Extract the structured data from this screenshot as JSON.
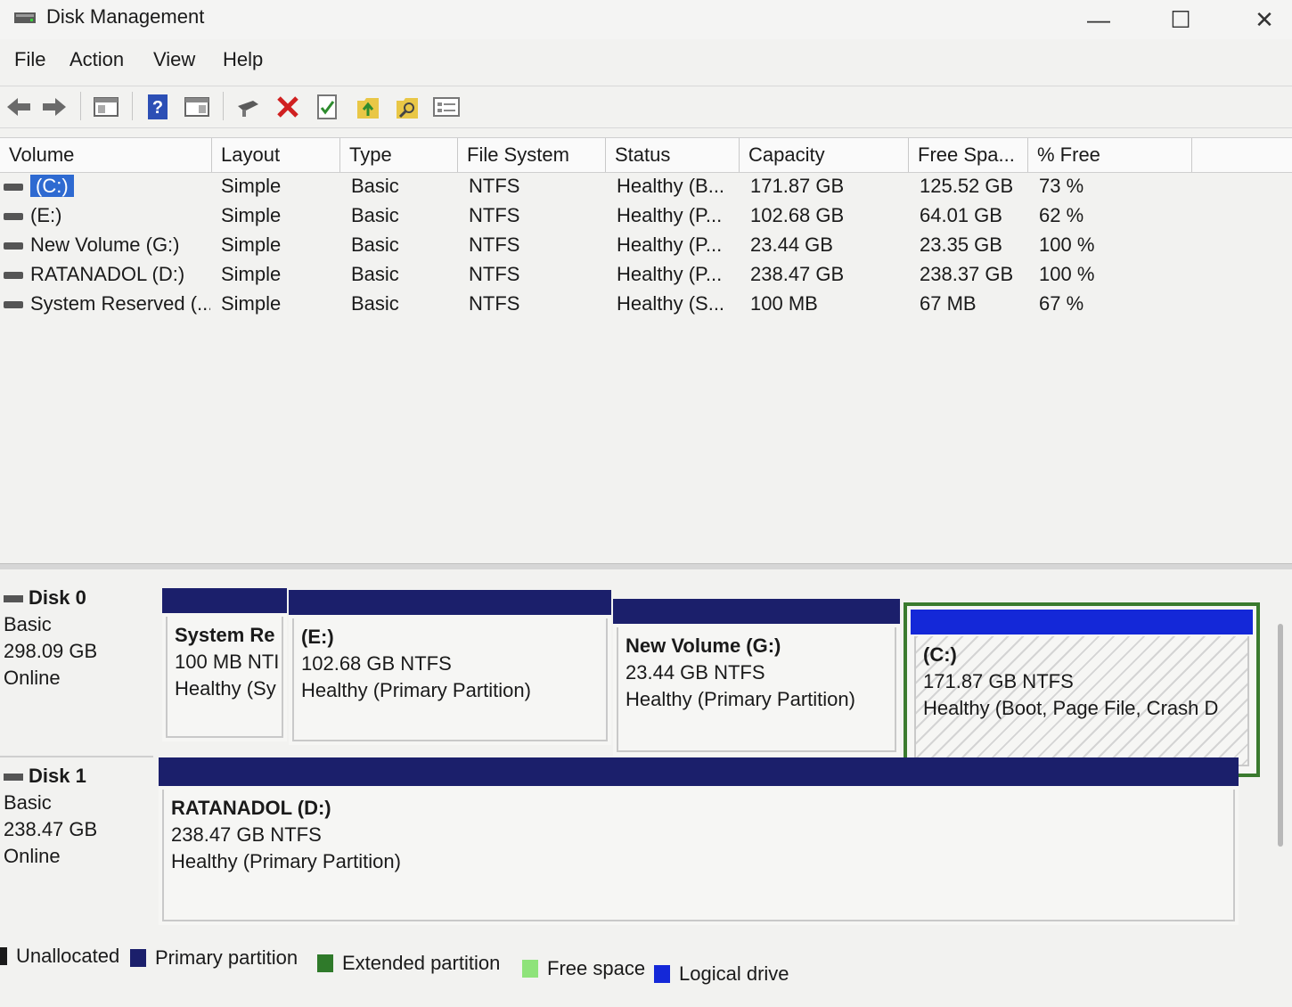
{
  "window": {
    "title": "Disk Management",
    "minimize": "—",
    "maximize": "☐",
    "close": "✕"
  },
  "menu": {
    "file": "File",
    "action": "Action",
    "view": "View",
    "help": "Help"
  },
  "toolbar": {
    "icons": [
      "back-arrow-icon",
      "forward-arrow-icon",
      "console-tree-icon",
      "help-icon",
      "show-hide-icon",
      "connect-icon",
      "delete-icon",
      "properties-icon",
      "export-icon",
      "search-icon",
      "settings-list-icon"
    ]
  },
  "columns": [
    "Volume",
    "Layout",
    "Type",
    "File System",
    "Status",
    "Capacity",
    "Free Spa...",
    "% Free"
  ],
  "volumes": [
    {
      "volume": "(C:)",
      "layout": "Simple",
      "type": "Basic",
      "fs": "NTFS",
      "status": "Healthy (B...",
      "capacity": "171.87 GB",
      "free": "125.52 GB",
      "pct": "73 %"
    },
    {
      "volume": "(E:)",
      "layout": "Simple",
      "type": "Basic",
      "fs": "NTFS",
      "status": "Healthy (P...",
      "capacity": "102.68 GB",
      "free": "64.01 GB",
      "pct": "62 %"
    },
    {
      "volume": "New Volume (G:)",
      "layout": "Simple",
      "type": "Basic",
      "fs": "NTFS",
      "status": "Healthy (P...",
      "capacity": "23.44 GB",
      "free": "23.35 GB",
      "pct": "100 %"
    },
    {
      "volume": "RATANADOL (D:)",
      "layout": "Simple",
      "type": "Basic",
      "fs": "NTFS",
      "status": "Healthy (P...",
      "capacity": "238.47 GB",
      "free": "238.37 GB",
      "pct": "100 %"
    },
    {
      "volume": "System Reserved (...",
      "layout": "Simple",
      "type": "Basic",
      "fs": "NTFS",
      "status": "Healthy (S...",
      "capacity": "100 MB",
      "free": "67 MB",
      "pct": "67 %"
    }
  ],
  "disks": [
    {
      "name": "Disk 0",
      "type": "Basic",
      "size": "298.09 GB",
      "state": "Online",
      "partitions": [
        {
          "title": "System Re",
          "size": "100 MB NTI",
          "status": "Healthy (Sy"
        },
        {
          "title": "(E:)",
          "size": "102.68 GB NTFS",
          "status": "Healthy (Primary Partition)"
        },
        {
          "title": "New Volume  (G:)",
          "size": "23.44 GB NTFS",
          "status": "Healthy (Primary Partition)"
        },
        {
          "title": "(C:)",
          "size": "171.87 GB NTFS",
          "status": "Healthy (Boot, Page File, Crash D"
        }
      ]
    },
    {
      "name": "Disk 1",
      "type": "Basic",
      "size": "238.47 GB",
      "state": "Online",
      "partitions": [
        {
          "title": "RATANADOL  (D:)",
          "size": "238.47 GB NTFS",
          "status": "Healthy (Primary Partition)"
        }
      ]
    }
  ],
  "legend": [
    {
      "label": "Unallocated",
      "color": "#1a1a1a"
    },
    {
      "label": "Primary partition",
      "color": "#1b1f6b"
    },
    {
      "label": "Extended partition",
      "color": "#2f7a2a"
    },
    {
      "label": "Free space",
      "color": "#8ee37a"
    },
    {
      "label": "Logical drive",
      "color": "#1428d8"
    }
  ],
  "colors": {
    "primary_bar": "#1b1f6b",
    "selected_bar": "#1428d8",
    "selection_frame": "#3a7a2e",
    "row_selected": "#2e6ad1"
  }
}
